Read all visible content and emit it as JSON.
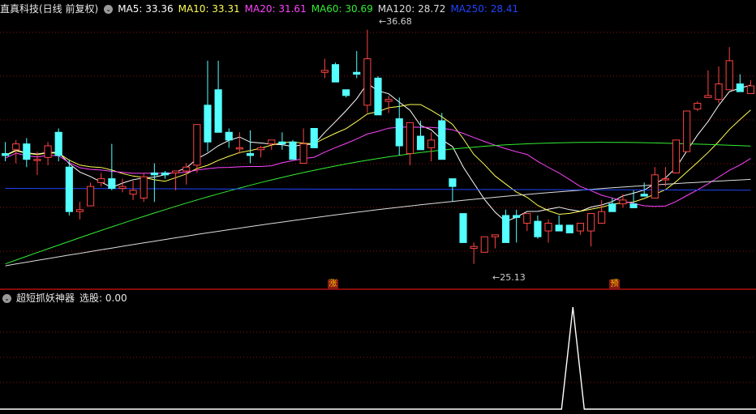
{
  "header": {
    "stock_title": "直真科技(日线 前复权)",
    "ma_labels": [
      {
        "text": "MA5: 33.36",
        "color": "#ffffff"
      },
      {
        "text": "MA10: 33.31",
        "color": "#ffff55"
      },
      {
        "text": "MA20: 31.61",
        "color": "#ff44ff"
      },
      {
        "text": "MA60: 30.69",
        "color": "#33ee33"
      },
      {
        "text": "MA120: 28.72",
        "color": "#dddddd"
      },
      {
        "text": "MA250: 28.41",
        "color": "#2244ff"
      }
    ]
  },
  "annotations": {
    "high_label": "36.68",
    "low_label": "25.13",
    "marker_up": "涨",
    "marker_pre": "预"
  },
  "indicator": {
    "title": "超短抓妖神器",
    "value_label": "选股: 0.00"
  },
  "colors": {
    "up": "#ff4444",
    "down": "#54ffff",
    "ma5": "#ffffff",
    "ma10": "#ffff55",
    "ma20": "#ff44ff",
    "ma60": "#33ee33",
    "ma120": "#dddddd",
    "ma250": "#2244ff",
    "grid": "#8a1010",
    "separator": "#b01010"
  },
  "chart_data": {
    "type": "candlestick",
    "price_range": [
      24.0,
      37.4
    ],
    "candles": [
      [
        30.3,
        30.9,
        29.9,
        30.2
      ],
      [
        30.5,
        31.0,
        29.8,
        30.8
      ],
      [
        30.8,
        31.1,
        29.6,
        30.0
      ],
      [
        30.0,
        30.4,
        29.2,
        30.0
      ],
      [
        30.1,
        30.9,
        29.7,
        30.7
      ],
      [
        31.4,
        31.6,
        29.9,
        30.2
      ],
      [
        29.6,
        30.0,
        27.1,
        27.3
      ],
      [
        27.3,
        27.8,
        26.9,
        27.4
      ],
      [
        27.6,
        28.8,
        27.6,
        28.6
      ],
      [
        28.8,
        29.3,
        28.6,
        29.0
      ],
      [
        29.0,
        30.8,
        28.4,
        28.5
      ],
      [
        28.5,
        29.0,
        28.3,
        28.6
      ],
      [
        28.2,
        28.9,
        27.9,
        28.4
      ],
      [
        28.0,
        29.3,
        27.8,
        29.1
      ],
      [
        29.3,
        29.8,
        27.8,
        29.2
      ],
      [
        29.3,
        29.4,
        29.0,
        29.2
      ],
      [
        29.3,
        29.4,
        28.4,
        29.4
      ],
      [
        29.4,
        29.8,
        28.7,
        29.6
      ],
      [
        29.7,
        30.2,
        29.3,
        31.8
      ],
      [
        32.8,
        35.1,
        30.4,
        30.9
      ],
      [
        33.6,
        35.1,
        32.0,
        31.4
      ],
      [
        31.4,
        31.6,
        30.6,
        31.0
      ],
      [
        30.6,
        31.4,
        30.3,
        30.6
      ],
      [
        30.3,
        31.5,
        29.8,
        30.2
      ],
      [
        30.5,
        30.7,
        30.1,
        30.6
      ],
      [
        30.8,
        31.0,
        30.5,
        31.0
      ],
      [
        30.9,
        31.4,
        30.5,
        30.8
      ],
      [
        30.9,
        31.0,
        30.0,
        30.0
      ],
      [
        29.8,
        31.6,
        29.8,
        30.8
      ],
      [
        31.6,
        31.2,
        31.3,
        30.6
      ],
      [
        34.5,
        35.2,
        34.2,
        34.6
      ],
      [
        34.9,
        35.0,
        34.4,
        34.0
      ],
      [
        33.6,
        33.4,
        33.2,
        33.3
      ],
      [
        34.5,
        35.6,
        34.2,
        34.4
      ],
      [
        32.8,
        36.7,
        32.4,
        35.2
      ],
      [
        34.2,
        34.3,
        32.3,
        32.3
      ],
      [
        33.0,
        33.3,
        32.4,
        33.1
      ],
      [
        32.1,
        33.2,
        30.2,
        30.7
      ],
      [
        30.3,
        31.6,
        29.7,
        31.9
      ],
      [
        31.2,
        32.0,
        30.7,
        30.5
      ],
      [
        30.6,
        31.4,
        29.9,
        31.0
      ],
      [
        32.0,
        32.4,
        30.7,
        30.0
      ],
      [
        29.0,
        29.0,
        27.8,
        28.6
      ],
      [
        27.2,
        27.2,
        26.6,
        25.7
      ],
      [
        25.4,
        25.7,
        24.6,
        25.5
      ],
      [
        25.2,
        25.8,
        25.2,
        26.0
      ],
      [
        26.0,
        26.1,
        25.4,
        26.1
      ],
      [
        27.1,
        27.4,
        26.4,
        25.7
      ],
      [
        27.1,
        27.4,
        25.7,
        27.0
      ],
      [
        26.7,
        27.2,
        26.3,
        27.2
      ],
      [
        26.8,
        27.1,
        25.9,
        26.0
      ],
      [
        26.3,
        26.9,
        25.7,
        26.7
      ],
      [
        26.6,
        27.1,
        26.8,
        26.3
      ],
      [
        26.6,
        26.4,
        26.5,
        26.2
      ],
      [
        26.3,
        26.5,
        26.1,
        26.7
      ],
      [
        26.3,
        27.0,
        25.5,
        27.2
      ],
      [
        26.7,
        27.9,
        27.8,
        27.3
      ],
      [
        27.7,
        28.0,
        27.5,
        27.3
      ],
      [
        27.7,
        28.2,
        27.5,
        27.9
      ],
      [
        27.7,
        28.4,
        28.1,
        27.5
      ],
      [
        28.2,
        28.8,
        28.8,
        28.1
      ],
      [
        28.0,
        29.6,
        28.4,
        29.2
      ],
      [
        29.0,
        29.6,
        28.6,
        29.0
      ],
      [
        29.3,
        29.8,
        29.6,
        31.0
      ],
      [
        30.4,
        32.0,
        31.3,
        32.5
      ],
      [
        32.6,
        33.0,
        32.5,
        32.9
      ],
      [
        33.2,
        34.6,
        33.6,
        33.3
      ],
      [
        33.1,
        34.8,
        32.9,
        33.9
      ],
      [
        33.6,
        35.8,
        34.0,
        35.1
      ],
      [
        33.9,
        34.4,
        33.6,
        33.5
      ],
      [
        33.4,
        34.1,
        33.5,
        33.8
      ]
    ],
    "ma_lines": {
      "MA5": {
        "start": 30.3,
        "end": 33.36
      },
      "MA10": {
        "start": 30.1,
        "end": 33.31
      },
      "MA20": {
        "start": 29.3,
        "end": 31.61
      },
      "MA60": {
        "start": 24.6,
        "end": 30.69
      },
      "MA120": {
        "start": 24.5,
        "end": 28.72
      },
      "MA250": {
        "start": 28.5,
        "end": 28.41
      }
    },
    "indicator_signal_index": 53,
    "indicator_value": 0.0
  }
}
